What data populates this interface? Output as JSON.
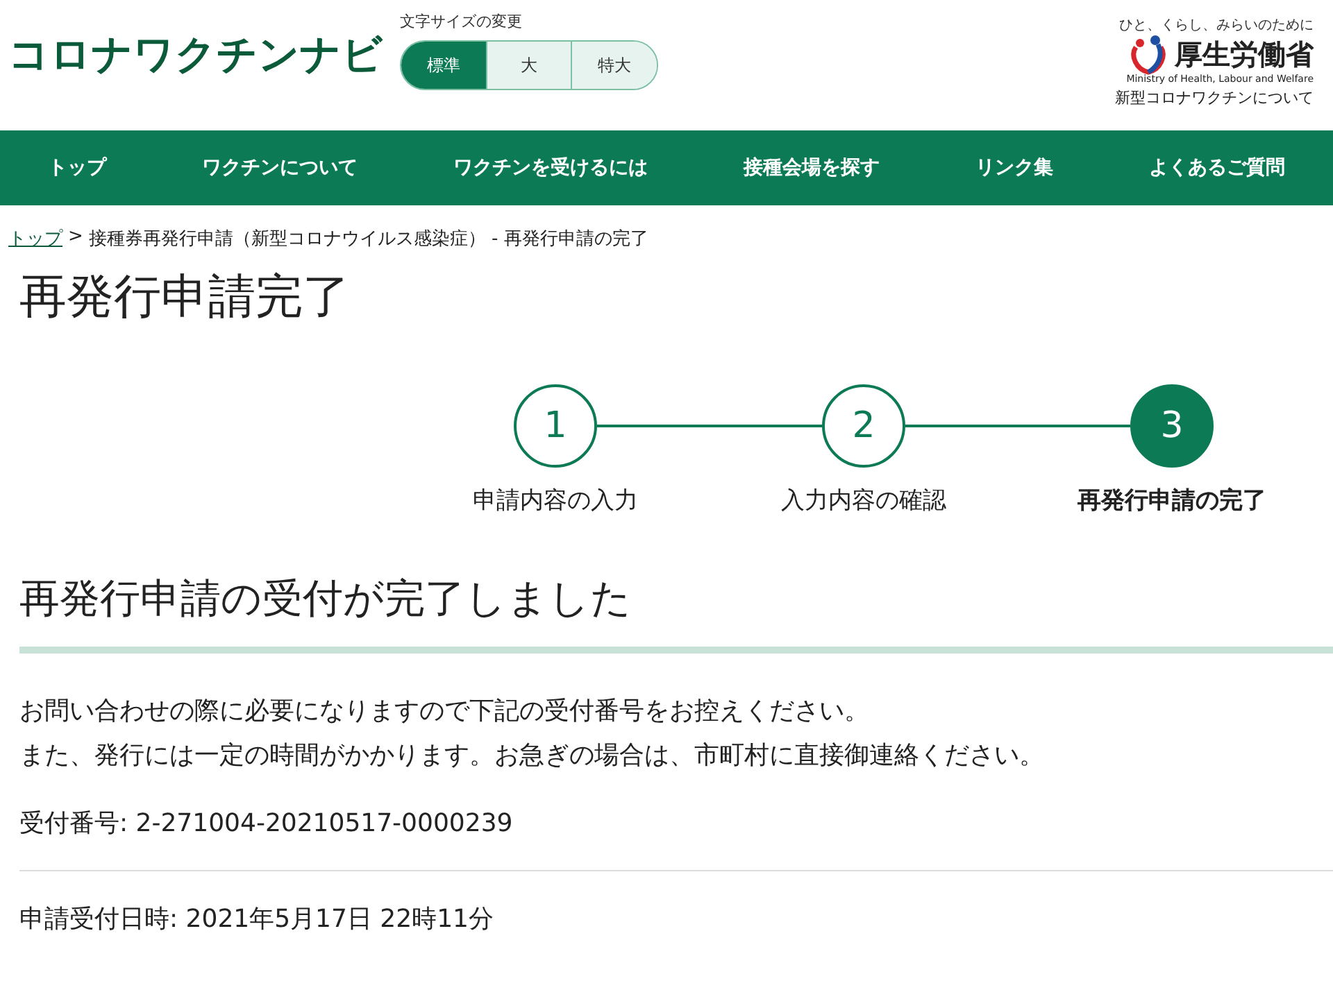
{
  "site_logo": "コロナワクチンナビ",
  "font_size": {
    "label": "文字サイズの変更",
    "options": [
      {
        "label": "標準",
        "selected": true
      },
      {
        "label": "大",
        "selected": false
      },
      {
        "label": "特大",
        "selected": false
      }
    ]
  },
  "ministry": {
    "tagline": "ひと、くらし、みらいのために",
    "name": "厚生労働省",
    "english": "Ministry of Health, Labour and Welfare",
    "subtitle": "新型コロナワクチンについて"
  },
  "nav": [
    "トップ",
    "ワクチンについて",
    "ワクチンを受けるには",
    "接種会場を探す",
    "リンク集",
    "よくあるご質問"
  ],
  "breadcrumb": {
    "link": "トップ",
    "separator": ">",
    "current": "接種券再発行申請（新型コロナウイルス感染症） - 再発行申請の完了"
  },
  "page_title": "再発行申請完了",
  "steps": [
    {
      "number": "1",
      "label": "申請内容の入力",
      "selected": false
    },
    {
      "number": "2",
      "label": "入力内容の確認",
      "selected": false
    },
    {
      "number": "3",
      "label": "再発行申請の完了",
      "selected": true
    }
  ],
  "heading": "再発行申請の受付が完了しました",
  "message": [
    "お問い合わせの際に必要になりますので下記の受付番号をお控えください。",
    "また、発行には一定の時間がかかります。お急ぎの場合は、市町村に直接御連絡ください。"
  ],
  "receipt_number": "受付番号: 2-271004-20210517-0000239",
  "application_datetime": "申請受付日時: 2021年5月17日 22時11分"
}
